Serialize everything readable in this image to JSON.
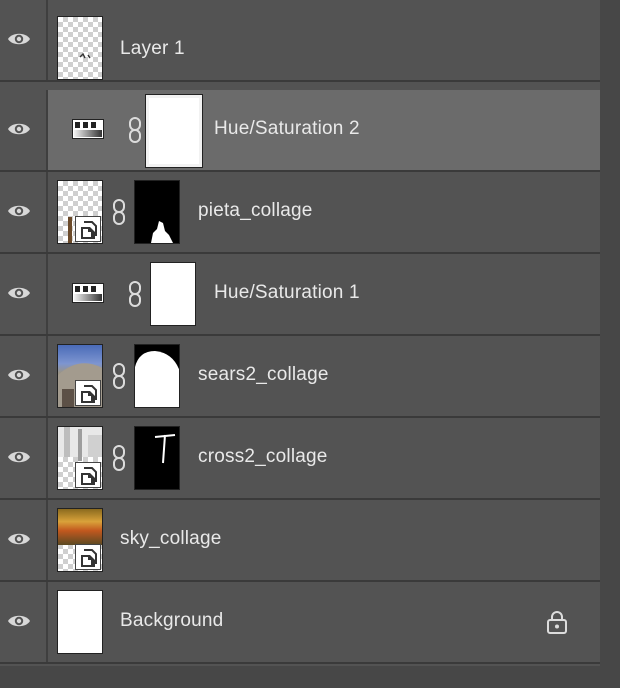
{
  "layers": [
    {
      "name": "Layer 1",
      "visible": true,
      "type": "pixel"
    },
    {
      "name": "Hue/Saturation 2",
      "visible": true,
      "type": "adjustment",
      "selected": true
    },
    {
      "name": "pieta_collage",
      "visible": true,
      "type": "smart-object-masked"
    },
    {
      "name": "Hue/Saturation 1",
      "visible": true,
      "type": "adjustment"
    },
    {
      "name": "sears2_collage",
      "visible": true,
      "type": "smart-object-masked"
    },
    {
      "name": "cross2_collage",
      "visible": true,
      "type": "smart-object-masked"
    },
    {
      "name": "sky_collage",
      "visible": true,
      "type": "smart-object"
    },
    {
      "name": "Background",
      "visible": true,
      "type": "background",
      "locked": true
    }
  ],
  "icons": {
    "visibility": "eye-icon",
    "link": "chain-link-icon",
    "adjustment": "hue-saturation-adjustment-icon",
    "smart_object": "smart-object-badge-icon",
    "lock": "lock-icon"
  },
  "colors": {
    "panel_bg": "#535353",
    "selected_row_bg": "#6b6b6b",
    "text": "#e9e9e9"
  }
}
